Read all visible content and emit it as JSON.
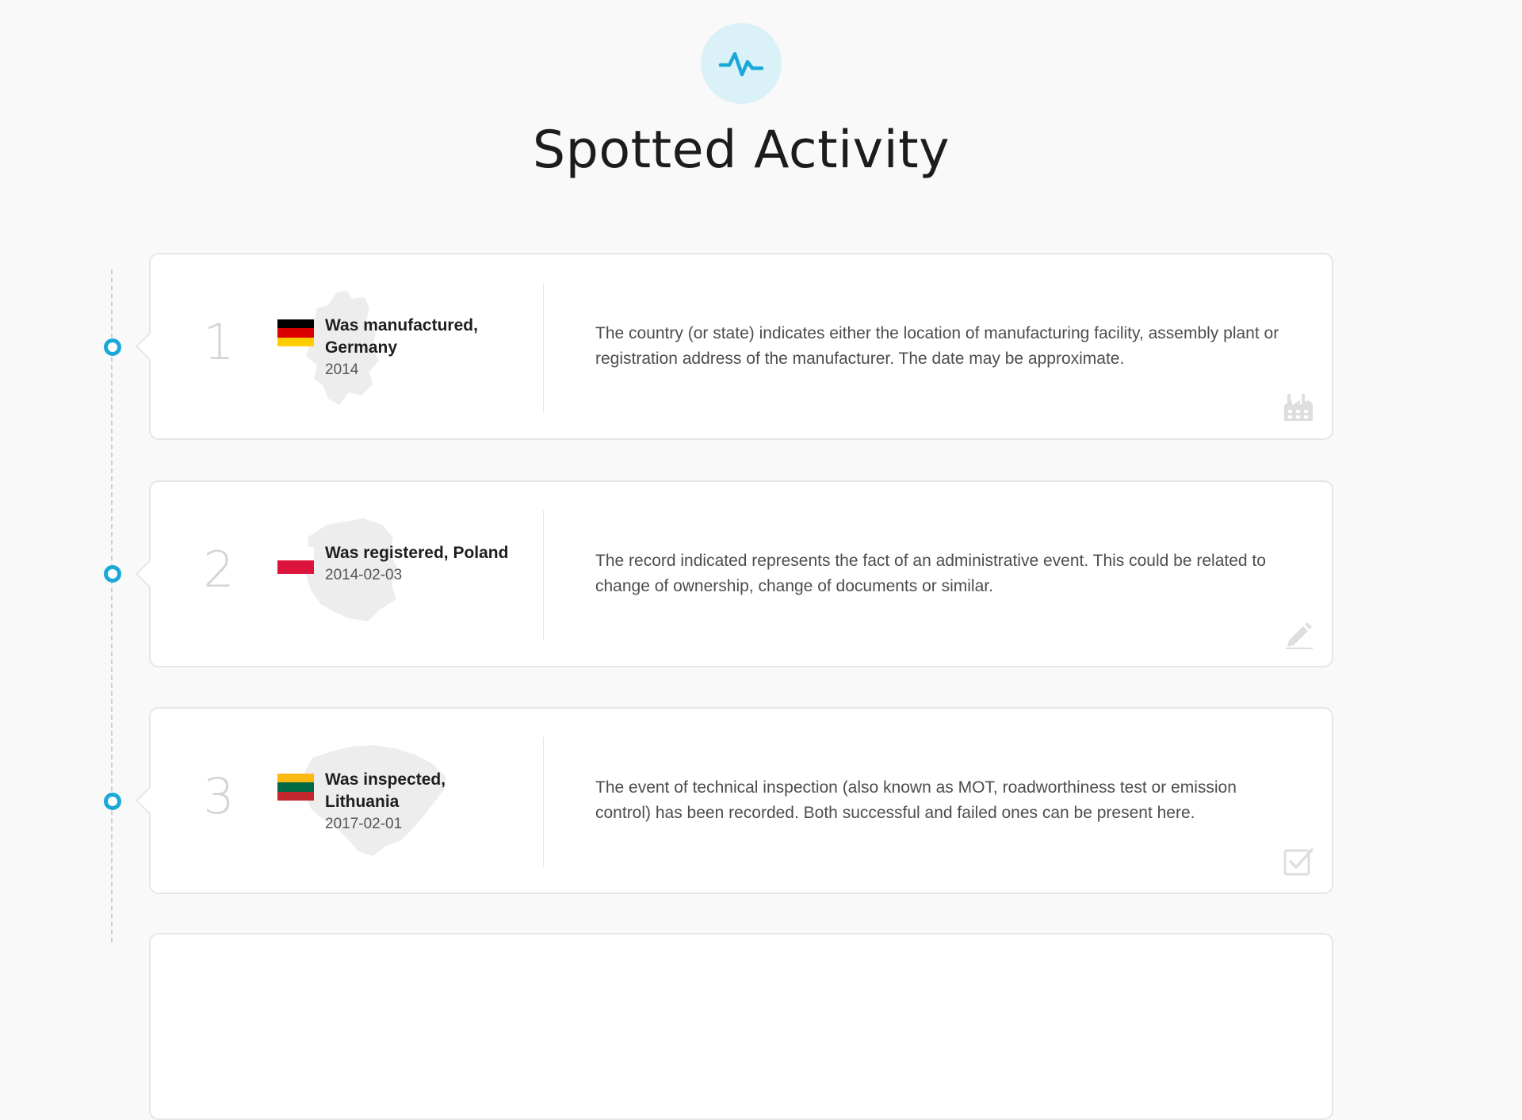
{
  "header": {
    "title": "Spotted Activity",
    "icon": "activity-pulse-icon",
    "accent_color": "#1aa8d8",
    "icon_bg_color": "#dbf1f8"
  },
  "events": [
    {
      "number": "1",
      "title": "Was manufactured, Germany",
      "date": "2014",
      "country_flag": "germany-flag-icon",
      "flag_colors": [
        "#000000",
        "#dd0000",
        "#ffce00"
      ],
      "description": "The country (or state) indicates either the location of manufacturing facility, assembly plant or registration address of the manufacturer. The date may be approximate.",
      "icon": "factory-icon"
    },
    {
      "number": "2",
      "title": "Was registered, Poland",
      "date": "2014-02-03",
      "country_flag": "poland-flag-icon",
      "flag_colors": [
        "#ffffff",
        "#dc143c"
      ],
      "description": "The record indicated represents the fact of an administrative event. This could be related to change of ownership, change of documents or similar.",
      "icon": "pencil-icon"
    },
    {
      "number": "3",
      "title": "Was inspected, Lithuania",
      "date": "2017-02-01",
      "country_flag": "lithuania-flag-icon",
      "flag_colors": [
        "#fdb913",
        "#006a44",
        "#c1272d"
      ],
      "description": "The event of technical inspection (also known as MOT, roadworthiness test or emission control) has been recorded. Both successful and failed ones can be present here.",
      "icon": "checkbox-checked-icon"
    }
  ]
}
